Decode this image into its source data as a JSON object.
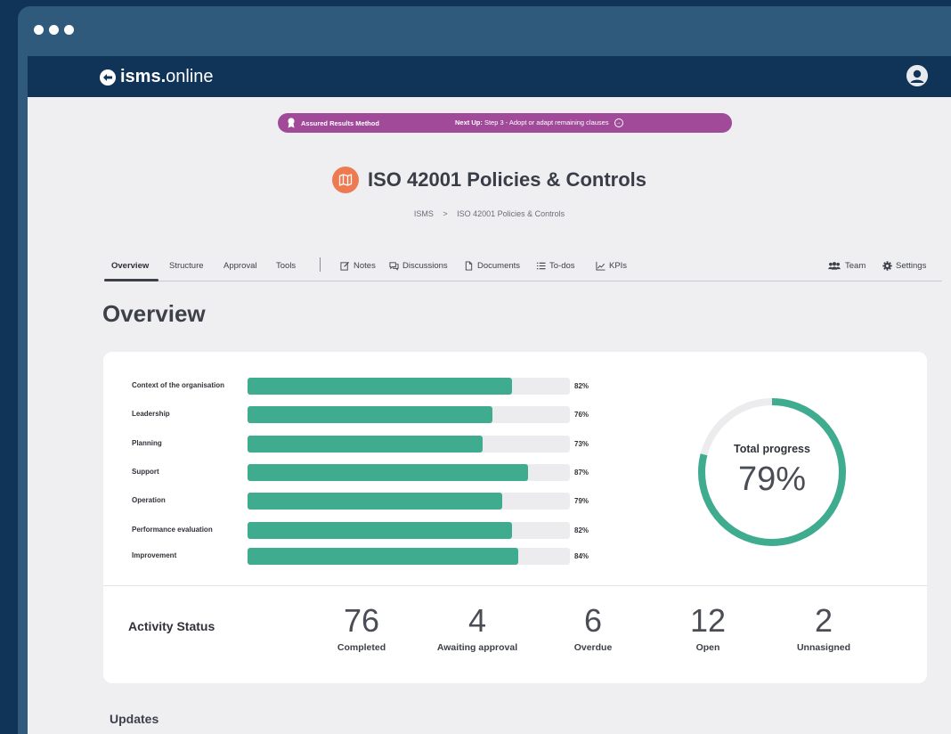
{
  "app": {
    "logo_bold": "isms.",
    "logo_light": "online"
  },
  "banner": {
    "method": "Assured Results Method",
    "next_up_label": "Next Up:",
    "next_up_text": "Step 3 - Adopt or adapt remaining clauses"
  },
  "page": {
    "title": "ISO 42001 Policies & Controls",
    "breadcrumb": [
      "ISMS",
      ">",
      "ISO 42001 Policies & Controls"
    ]
  },
  "tabs": {
    "left": [
      "Overview",
      "Structure",
      "Approval",
      "Tools"
    ],
    "tools": [
      {
        "label": "Notes",
        "icon": "edit-icon"
      },
      {
        "label": "Discussions",
        "icon": "chat-icon"
      },
      {
        "label": "Documents",
        "icon": "document-icon"
      },
      {
        "label": "To-dos",
        "icon": "list-icon"
      },
      {
        "label": "KPIs",
        "icon": "chart-icon"
      }
    ],
    "right": [
      {
        "label": "Team",
        "icon": "team-icon"
      },
      {
        "label": "Settings",
        "icon": "gear-icon"
      }
    ]
  },
  "overview": {
    "heading": "Overview",
    "clauses": [
      {
        "label": "Context of the organisation",
        "percent": 82,
        "display": "82%"
      },
      {
        "label": "Leadership",
        "percent": 76,
        "display": "76%"
      },
      {
        "label": "Planning",
        "percent": 73,
        "display": "73%"
      },
      {
        "label": "Support",
        "percent": 87,
        "display": "87%"
      },
      {
        "label": "Operation",
        "percent": 79,
        "display": "79%"
      },
      {
        "label": "Performance evaluation",
        "percent": 82,
        "display": "82%"
      },
      {
        "label": "Improvement",
        "percent": 84,
        "display": "84%"
      }
    ],
    "total": {
      "label": "Total progress",
      "percent": 79,
      "display": "79%"
    }
  },
  "activity": {
    "title": "Activity Status",
    "stats": [
      {
        "value": "76",
        "label": "Completed"
      },
      {
        "value": "4",
        "label": "Awaiting approval"
      },
      {
        "value": "6",
        "label": "Overdue"
      },
      {
        "value": "12",
        "label": "Open"
      },
      {
        "value": "2",
        "label": "Unnasigned"
      }
    ]
  },
  "updates": {
    "heading": "Updates"
  },
  "colors": {
    "progress": "#3fab8f",
    "brand_navy": "#0f3457",
    "banner": "#a14a9a",
    "title_icon": "#ee7a52"
  }
}
